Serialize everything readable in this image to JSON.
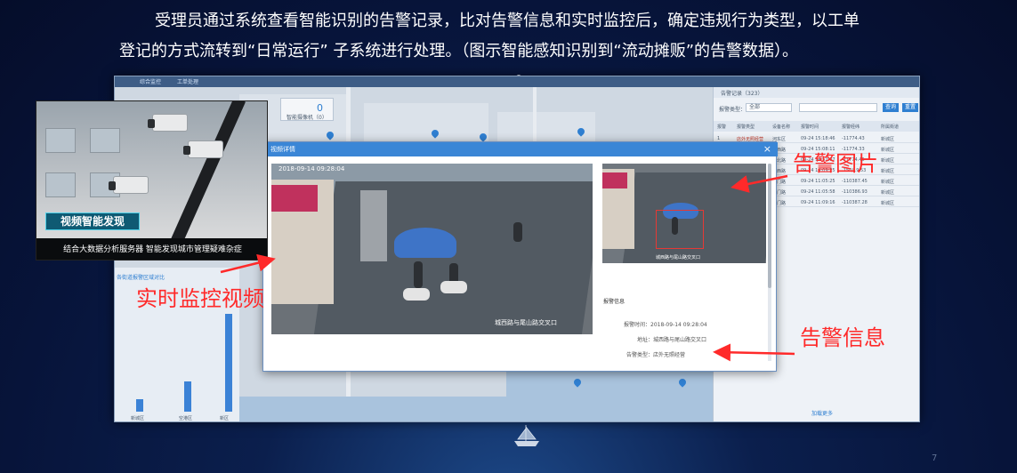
{
  "intro": {
    "line1": "受理员通过系统查看智能识别的告警记录，比对告警信息和实时监控后，确定违规行为类型，以工单",
    "line2": "登记的方式流转到“日常运行” 子系统进行处理。（图示智能感知识别到“流动摊贩”的告警数据）。"
  },
  "inset": {
    "badge": "视频智能发现",
    "caption": "结合大数据分析服务器 智能发现城市管理疑难杂症"
  },
  "modal": {
    "title": "视频详情",
    "video_timestamp": "2018-09-14 09:28:04",
    "video_location": "城西路与尾山路交叉口",
    "alarm_image_location": "城西路与尾山路交叉口",
    "info_title": "报警信息",
    "alarm_time": "报警时间：2018-09-14 09:28:04",
    "address": "地址：城西路与尾山路交叉口",
    "alarm_type": "告警类型：店外无照经营"
  },
  "alarm_panel": {
    "head": "告警记录（323）",
    "filter_label": "报警类型：",
    "filter_value": "全部",
    "btn_query": "查询",
    "btn_reset": "重置",
    "columns": [
      "报警",
      "报警类型",
      "设备名称",
      "报警时间",
      "报警经纬",
      "所属街道"
    ],
    "rows": [
      [
        "1",
        "店外无照经营",
        "河东区",
        "09-24 15:18:46",
        "-11774.43",
        "新城区"
      ],
      [
        "2",
        "店外无照经营",
        "城西路",
        "09-24 15:08:11",
        "-11774.33",
        "新城区"
      ],
      [
        "3",
        "店外无照经营",
        "城北路",
        "09-24 14:52:07",
        "-11774.45",
        "新城区"
      ],
      [
        "4",
        "店外无照经营",
        "河西路",
        "09-24 14:09:25",
        "-154/19.53",
        "新城区"
      ],
      [
        "5",
        "店外无照经营",
        "南门路",
        "09-24 11:05:25",
        "-110387.45",
        "新城区"
      ],
      [
        "6",
        "店外无照经营",
        "北门路",
        "09-24 11:05:58",
        "-110386.93",
        "新城区"
      ],
      [
        "7",
        "店外无照经营",
        "东门路",
        "09-24 11:09:16",
        "-110387.28",
        "新城区"
      ]
    ],
    "more": "加载更多"
  },
  "stats": {
    "title": "各街道报警区域对比",
    "bars": [
      {
        "label": "新城区",
        "value": 10
      },
      {
        "label": "空港区",
        "value": 24
      },
      {
        "label": "新区",
        "value": 78
      }
    ]
  },
  "map_toolbox": {
    "count": "0",
    "label": "智能摄像机（0）"
  },
  "topbar": {
    "tab1": "综合监控",
    "tab2": "工单处理"
  },
  "notes": {
    "alarm_image": "告警图片",
    "live_video": "实时监控视频",
    "alarm_info": "告警信息"
  },
  "page_number": "7",
  "colors": {
    "accent": "#3a86d6",
    "annotation": "#ff2a2a",
    "background": "#07143a"
  }
}
